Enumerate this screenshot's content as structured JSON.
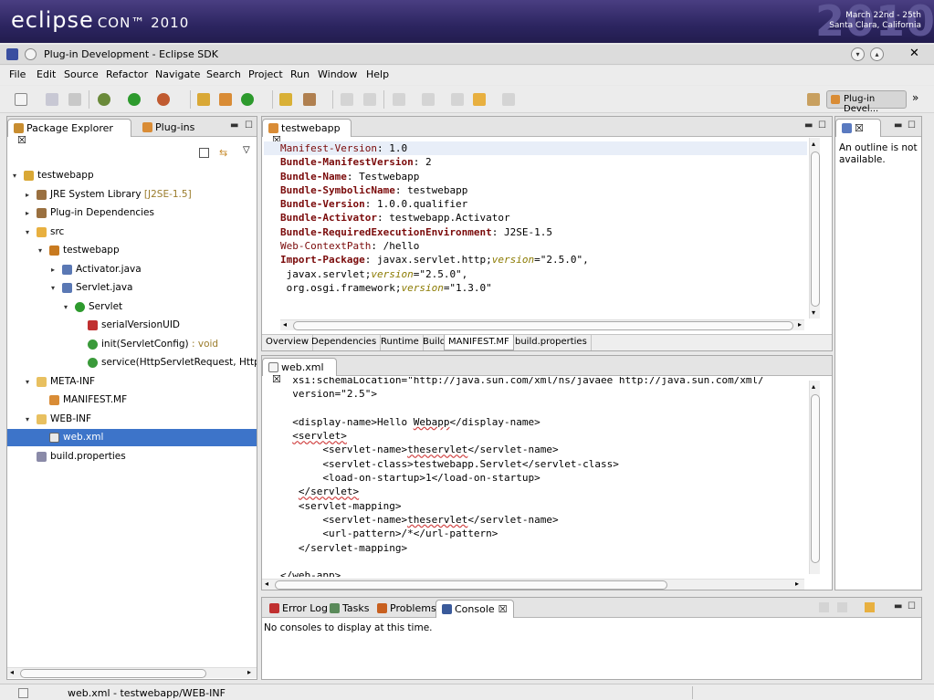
{
  "banner": {
    "logo_main": "eclipse",
    "logo_con": "CON™ 2010",
    "ghost_year": "2010",
    "date_line1": "March 22nd - 25th",
    "date_line2": "Santa Clara, California"
  },
  "window": {
    "title": "Plug-in Development - Eclipse SDK"
  },
  "menu": [
    "File",
    "Edit",
    "Source",
    "Refactor",
    "Navigate",
    "Search",
    "Project",
    "Run",
    "Window",
    "Help"
  ],
  "toolbar": {
    "perspective_label": "Plug-in Devel...",
    "overflow": "»"
  },
  "explorer": {
    "tabs": [
      {
        "label": "Package Explorer",
        "close": "☒"
      },
      {
        "label": "Plug-ins"
      }
    ],
    "tree": [
      {
        "label": "testwebapp",
        "depth": 0,
        "arrow": "▾",
        "icon": "project-icon"
      },
      {
        "label": "JRE System Library",
        "suffix": "[J2SE-1.5]",
        "depth": 1,
        "arrow": "▸",
        "icon": "library-icon"
      },
      {
        "label": "Plug-in Dependencies",
        "depth": 1,
        "arrow": "▸",
        "icon": "library-icon"
      },
      {
        "label": "src",
        "depth": 1,
        "arrow": "▾",
        "icon": "source-folder-icon"
      },
      {
        "label": "testwebapp",
        "depth": 2,
        "arrow": "▾",
        "icon": "package-icon"
      },
      {
        "label": "Activator.java",
        "depth": 3,
        "arrow": "▸",
        "icon": "java-file-icon"
      },
      {
        "label": "Servlet.java",
        "depth": 3,
        "arrow": "▾",
        "icon": "java-file-icon"
      },
      {
        "label": "Servlet",
        "depth": 4,
        "arrow": "▾",
        "icon": "class-icon"
      },
      {
        "label": "serialVersionUID",
        "depth": 5,
        "arrow": "",
        "icon": "field-icon"
      },
      {
        "label": "init(ServletConfig)",
        "suffix": ": void",
        "depth": 5,
        "arrow": "",
        "icon": "method-icon"
      },
      {
        "label": "service(HttpServletRequest, HttpSe",
        "depth": 5,
        "arrow": "",
        "icon": "method-icon"
      },
      {
        "label": "META-INF",
        "depth": 1,
        "arrow": "▾",
        "icon": "folder-icon"
      },
      {
        "label": "MANIFEST.MF",
        "depth": 2,
        "arrow": "",
        "icon": "manifest-icon"
      },
      {
        "label": "WEB-INF",
        "depth": 1,
        "arrow": "▾",
        "icon": "folder-icon"
      },
      {
        "label": "web.xml",
        "depth": 2,
        "arrow": "",
        "icon": "xml-file-icon",
        "selected": true
      },
      {
        "label": "build.properties",
        "depth": 1,
        "arrow": "",
        "icon": "properties-file-icon"
      }
    ]
  },
  "manifest_editor": {
    "tab_label": "testwebapp",
    "close": "☒",
    "lines": [
      [
        {
          "t": "Manifest-Version",
          "c": "ik"
        },
        {
          "t": ": 1.0"
        }
      ],
      [
        {
          "t": "Bundle-ManifestVersion",
          "c": "kw"
        },
        {
          "t": ": 2"
        }
      ],
      [
        {
          "t": "Bundle-Name",
          "c": "kw"
        },
        {
          "t": ": Testwebapp"
        }
      ],
      [
        {
          "t": "Bundle-SymbolicName",
          "c": "kw"
        },
        {
          "t": ": testwebapp"
        }
      ],
      [
        {
          "t": "Bundle-Version",
          "c": "kw"
        },
        {
          "t": ": 1.0.0.qualifier"
        }
      ],
      [
        {
          "t": "Bundle-Activator",
          "c": "kw"
        },
        {
          "t": ": testwebapp.Activator"
        }
      ],
      [
        {
          "t": "Bundle-RequiredExecutionEnvironment",
          "c": "kw"
        },
        {
          "t": ": J2SE-1.5"
        }
      ],
      [
        {
          "t": "Web-ContextPath",
          "c": "ik"
        },
        {
          "t": ": /hello"
        }
      ],
      [
        {
          "t": "Import-Package",
          "c": "kw"
        },
        {
          "t": ": javax.servlet.http;"
        },
        {
          "t": "version",
          "c": "it"
        },
        {
          "t": "=\"2.5.0\","
        }
      ],
      [
        {
          "t": " javax.servlet;"
        },
        {
          "t": "version",
          "c": "it"
        },
        {
          "t": "=\"2.5.0\","
        }
      ],
      [
        {
          "t": " org.osgi.framework;"
        },
        {
          "t": "version",
          "c": "it"
        },
        {
          "t": "=\"1.3.0\""
        }
      ]
    ],
    "page_tabs": [
      "Overview",
      "Dependencies",
      "Runtime",
      "Build",
      "MANIFEST.MF",
      "build.properties"
    ],
    "active_page_tab": "MANIFEST.MF"
  },
  "xml_editor": {
    "tab_label": "web.xml",
    "close": "☒",
    "lines": [
      [
        {
          "t": "  xsi:schemaLocation=\"http://java.sun.com/xml/ns/javaee http://java.sun.com/xml/"
        }
      ],
      [
        {
          "t": "  version=\"2.5\">"
        }
      ],
      [
        {
          "t": ""
        }
      ],
      [
        {
          "t": "  <display-name>Hello "
        },
        {
          "t": "Webapp",
          "c": "sq"
        },
        {
          "t": "</display-name>"
        }
      ],
      [
        {
          "t": "  "
        },
        {
          "t": "<servlet>",
          "c": "sq"
        }
      ],
      [
        {
          "t": "       <servlet-name>"
        },
        {
          "t": "theservlet",
          "c": "sq"
        },
        {
          "t": "</servlet-name>"
        }
      ],
      [
        {
          "t": "       <servlet-class>testwebapp.Servlet</servlet-class>"
        }
      ],
      [
        {
          "t": "       <load-on-startup>1</load-on-startup>"
        }
      ],
      [
        {
          "t": "   "
        },
        {
          "t": "</servlet>",
          "c": "sq"
        }
      ],
      [
        {
          "t": "   <servlet-mapping>"
        }
      ],
      [
        {
          "t": "       <servlet-name>"
        },
        {
          "t": "theservlet",
          "c": "sq"
        },
        {
          "t": "</servlet-name>"
        }
      ],
      [
        {
          "t": "       <url-pattern>/*</url-pattern>"
        }
      ],
      [
        {
          "t": "   </servlet-mapping>"
        }
      ],
      [
        {
          "t": ""
        }
      ],
      [
        {
          "t": "</web-app>"
        }
      ]
    ]
  },
  "outline": {
    "message": "An outline is not available."
  },
  "console": {
    "tabs": [
      {
        "label": "Error Log"
      },
      {
        "label": "Tasks"
      },
      {
        "label": "Problems"
      },
      {
        "label": "Console",
        "close": "☒",
        "active": true
      }
    ],
    "message": "No consoles to display at this time."
  },
  "status": {
    "text": "web.xml - testwebapp/WEB-INF"
  },
  "colors": {
    "banner": "#2c2560",
    "selection": "#3d74c9",
    "keyword": "#7a0a0a",
    "attribute": "#8b7a00"
  }
}
